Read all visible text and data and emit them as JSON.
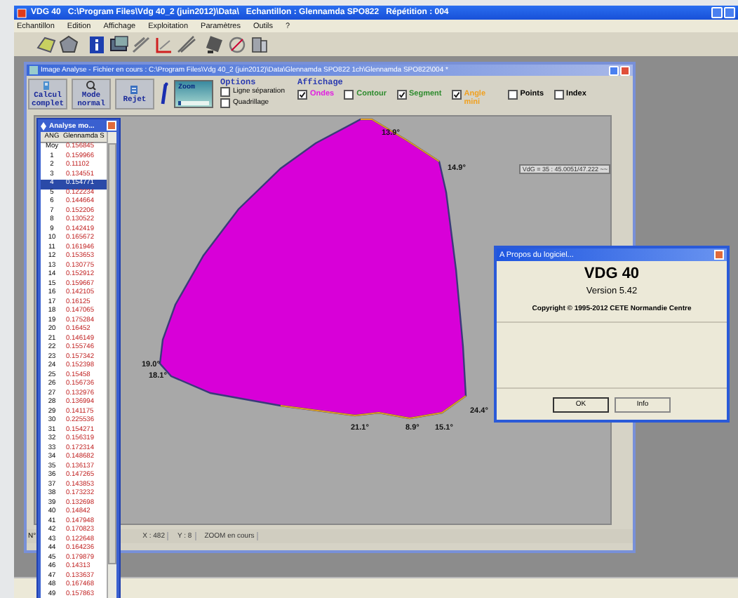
{
  "window": {
    "title": "VDG 40   C:\\Program Files\\Vdg 40_2 (juin2012)\\Data\\   Echantillon : Glennamda SPO822   Répétition : 004"
  },
  "menu": [
    "Echantillon",
    "Edition",
    "Affichage",
    "Exploitation",
    "Paramètres",
    "Outils",
    "?"
  ],
  "analysis_window": {
    "title": "Image Analyse - Fichier en cours : C:\\Program Files\\Vdg 40_2 (juin2012)\\Data\\Glennamda SPO822 1ch\\Glennamda SPO822\\004 *",
    "buttons": [
      {
        "kind": "calc",
        "lines": [
          "Calcul",
          "complet"
        ]
      },
      {
        "kind": "mode",
        "lines": [
          "Mode",
          "normal"
        ]
      },
      {
        "kind": "reject",
        "lines": [
          "Rejet"
        ]
      }
    ],
    "zoom": {
      "label": "Zoom",
      "level": 0.1
    },
    "options": {
      "title": "Options",
      "items": [
        {
          "label": "Ligne séparation",
          "checked": false
        },
        {
          "label": "Quadrillage",
          "checked": false
        }
      ]
    },
    "display": {
      "title": "Affichage",
      "items": [
        {
          "label": "Ondes",
          "checked": true,
          "color": "#e020e0"
        },
        {
          "label": "Contour",
          "checked": false,
          "color": "#2e8b2e"
        },
        {
          "label": "Segment",
          "checked": true,
          "color": "#2e8b2e"
        },
        {
          "label": "Angle mini",
          "checked": true,
          "color": "#f0a020"
        },
        {
          "label": "Points",
          "checked": false,
          "color": "#000000"
        },
        {
          "label": "Index",
          "checked": false,
          "color": "#000000"
        }
      ]
    },
    "angle_labels": [
      "13.9°",
      "14.9°",
      "19.0°",
      "18.1°",
      "24.4°",
      "21.1°",
      "8.9°",
      "15.1°"
    ],
    "readout": "VdG = 35 : 45.0051/47.222 ~~",
    "status": {
      "left": "N°",
      "x": "X : 482",
      "y": "Y : 8",
      "mode": "ZOOM en cours"
    }
  },
  "list_window": {
    "title": "Analyse mo...",
    "columns": [
      "ANG",
      "Glennamda S"
    ],
    "rows": [
      {
        "index": "Moy",
        "value": "0.156845",
        "selected": false
      },
      {
        "index": "1",
        "value": "0.159966",
        "selected": false
      },
      {
        "index": "2",
        "value": "0.11102",
        "selected": false
      },
      {
        "index": "3",
        "value": "0.134551",
        "selected": false
      },
      {
        "index": "4",
        "value": "0.154771",
        "selected": true
      },
      {
        "index": "5",
        "value": "0.122234",
        "selected": false
      },
      {
        "index": "6",
        "value": "0.144664",
        "selected": false
      },
      {
        "index": "7",
        "value": "0.152206",
        "selected": false
      },
      {
        "index": "8",
        "value": "0.130522",
        "selected": false
      },
      {
        "index": "9",
        "value": "0.142419",
        "selected": false
      },
      {
        "index": "10",
        "value": "0.165672",
        "selected": false
      },
      {
        "index": "11",
        "value": "0.161946",
        "selected": false
      },
      {
        "index": "12",
        "value": "0.153653",
        "selected": false
      },
      {
        "index": "13",
        "value": "0.130775",
        "selected": false
      },
      {
        "index": "14",
        "value": "0.152912",
        "selected": false
      },
      {
        "index": "15",
        "value": "0.159667",
        "selected": false
      },
      {
        "index": "16",
        "value": "0.142105",
        "selected": false
      },
      {
        "index": "17",
        "value": "0.16125",
        "selected": false
      },
      {
        "index": "18",
        "value": "0.147065",
        "selected": false
      },
      {
        "index": "19",
        "value": "0.175284",
        "selected": false
      },
      {
        "index": "20",
        "value": "0.16452",
        "selected": false
      },
      {
        "index": "21",
        "value": "0.146149",
        "selected": false
      },
      {
        "index": "22",
        "value": "0.155746",
        "selected": false
      },
      {
        "index": "23",
        "value": "0.157342",
        "selected": false
      },
      {
        "index": "24",
        "value": "0.152398",
        "selected": false
      },
      {
        "index": "25",
        "value": "0.15458",
        "selected": false
      },
      {
        "index": "26",
        "value": "0.156736",
        "selected": false
      },
      {
        "index": "27",
        "value": "0.132976",
        "selected": false
      },
      {
        "index": "28",
        "value": "0.136994",
        "selected": false
      },
      {
        "index": "29",
        "value": "0.141175",
        "selected": false
      },
      {
        "index": "30",
        "value": "0.225536",
        "selected": false
      },
      {
        "index": "31",
        "value": "0.154271",
        "selected": false
      },
      {
        "index": "32",
        "value": "0.156319",
        "selected": false
      },
      {
        "index": "33",
        "value": "0.172314",
        "selected": false
      },
      {
        "index": "34",
        "value": "0.148682",
        "selected": false
      },
      {
        "index": "35",
        "value": "0.136137",
        "selected": false
      },
      {
        "index": "36",
        "value": "0.147265",
        "selected": false
      },
      {
        "index": "37",
        "value": "0.143853",
        "selected": false
      },
      {
        "index": "38",
        "value": "0.173232",
        "selected": false
      },
      {
        "index": "39",
        "value": "0.132698",
        "selected": false
      },
      {
        "index": "40",
        "value": "0.14842",
        "selected": false
      },
      {
        "index": "41",
        "value": "0.147948",
        "selected": false
      },
      {
        "index": "42",
        "value": "0.170823",
        "selected": false
      },
      {
        "index": "43",
        "value": "0.122648",
        "selected": false
      },
      {
        "index": "44",
        "value": "0.164236",
        "selected": false
      },
      {
        "index": "45",
        "value": "0.179879",
        "selected": false
      },
      {
        "index": "46",
        "value": "0.14313",
        "selected": false
      },
      {
        "index": "47",
        "value": "0.133637",
        "selected": false
      },
      {
        "index": "48",
        "value": "0.167468",
        "selected": false
      },
      {
        "index": "49",
        "value": "0.157863",
        "selected": false
      }
    ]
  },
  "about_dialog": {
    "title": "A Propos du logiciel...",
    "product": "VDG 40",
    "version": "Version 5.42",
    "copyright": "Copyright © 1995-2012 CETE Normandie Centre",
    "buttons": [
      "OK",
      "Info"
    ]
  }
}
